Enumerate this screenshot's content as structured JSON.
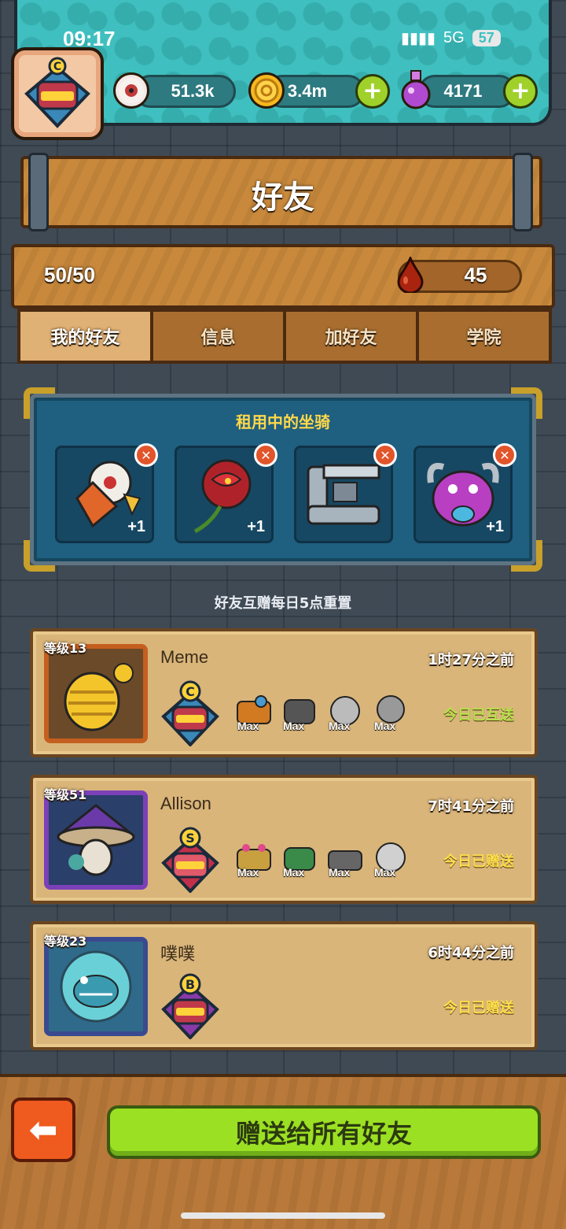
{
  "status_bar": {
    "time": "09:17",
    "network": "5G",
    "battery": "57"
  },
  "resources": {
    "eyes": "51.3k",
    "coins": "3.4m",
    "potions": "4171",
    "player_rank": "C"
  },
  "title": "好友",
  "friend_count": "50/50",
  "drop_count": "45",
  "tabs": [
    "我的好友",
    "信息",
    "加好友",
    "学院"
  ],
  "rental": {
    "title": "租用中的坐骑",
    "slots": [
      {
        "name": "lion-dance-mount",
        "bonus": "+1"
      },
      {
        "name": "red-rose-mount",
        "bonus": "+1"
      },
      {
        "name": "mech-cannon-mount",
        "bonus": "+1"
      },
      {
        "name": "purple-horned-monster-mount",
        "bonus": "+1"
      }
    ]
  },
  "reset_note": "好友互赠每日5点重置",
  "friends": [
    {
      "level": "等级13",
      "name": "Meme",
      "time": "1时27分之前",
      "rank": "C",
      "status": "今日已互送",
      "mount_tag": "Max"
    },
    {
      "level": "等级51",
      "name": "Allison",
      "time": "7时41分之前",
      "rank": "S",
      "status": "今日已赠送",
      "mount_tag": "Max"
    },
    {
      "level": "等级23",
      "name": "噗噗",
      "time": "6时44分之前",
      "rank": "B",
      "status": "今日已赠送"
    }
  ],
  "send_all_label": "赠送给所有好友",
  "colors": {
    "wood": "#c9893c",
    "teal": "#3fbfbf",
    "green_button": "#9be023",
    "accent_yellow": "#ffd84a"
  }
}
